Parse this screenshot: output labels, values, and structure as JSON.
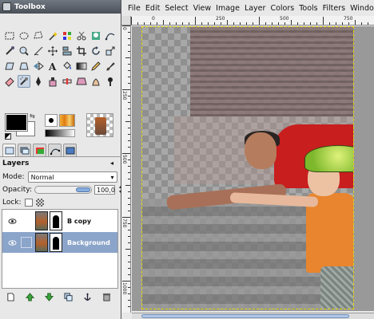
{
  "toolbox": {
    "title": "Toolbox",
    "tools": [
      "rect-select-icon",
      "ellipse-select-icon",
      "free-select-icon",
      "fuzzy-select-icon",
      "select-by-color-icon",
      "scissors-select-icon",
      "foreground-select-icon",
      "paths-icon",
      "color-picker-icon",
      "zoom-icon",
      "measure-icon",
      "move-icon",
      "align-icon",
      "crop-icon",
      "rotate-icon",
      "scale-icon",
      "shear-icon",
      "perspective-icon",
      "flip-icon",
      "text-icon",
      "bucket-fill-icon",
      "blend-icon",
      "pencil-icon",
      "paintbrush-icon",
      "eraser-icon",
      "airbrush-icon",
      "ink-icon",
      "clone-icon",
      "heal-icon",
      "perspective-clone-icon",
      "smudge-icon",
      "dodge-burn-icon"
    ],
    "active_tool_index": 25,
    "colors": {
      "foreground": "#000000",
      "background": "#ffffff"
    }
  },
  "layers": {
    "header": "Layers",
    "mode_label": "Mode:",
    "mode_value": "Normal",
    "opacity_label": "Opacity:",
    "opacity_value": "100,0",
    "opacity_fraction": 1.0,
    "lock_label": "Lock:",
    "items": [
      {
        "name": "B copy",
        "visible": true,
        "selected": false
      },
      {
        "name": "Background",
        "visible": true,
        "selected": true
      }
    ],
    "buttons": [
      "new-layer-icon",
      "raise-layer-icon",
      "lower-layer-icon",
      "duplicate-layer-icon",
      "anchor-layer-icon",
      "delete-layer-icon"
    ]
  },
  "image_window": {
    "menu": [
      "File",
      "Edit",
      "Select",
      "View",
      "Image",
      "Layer",
      "Colors",
      "Tools",
      "Filters",
      "Windo"
    ],
    "ruler_top_labels": [
      "0",
      "250",
      "500",
      "750"
    ],
    "ruler_left_labels": [
      "0",
      "250",
      "500",
      "750",
      "1000"
    ]
  }
}
